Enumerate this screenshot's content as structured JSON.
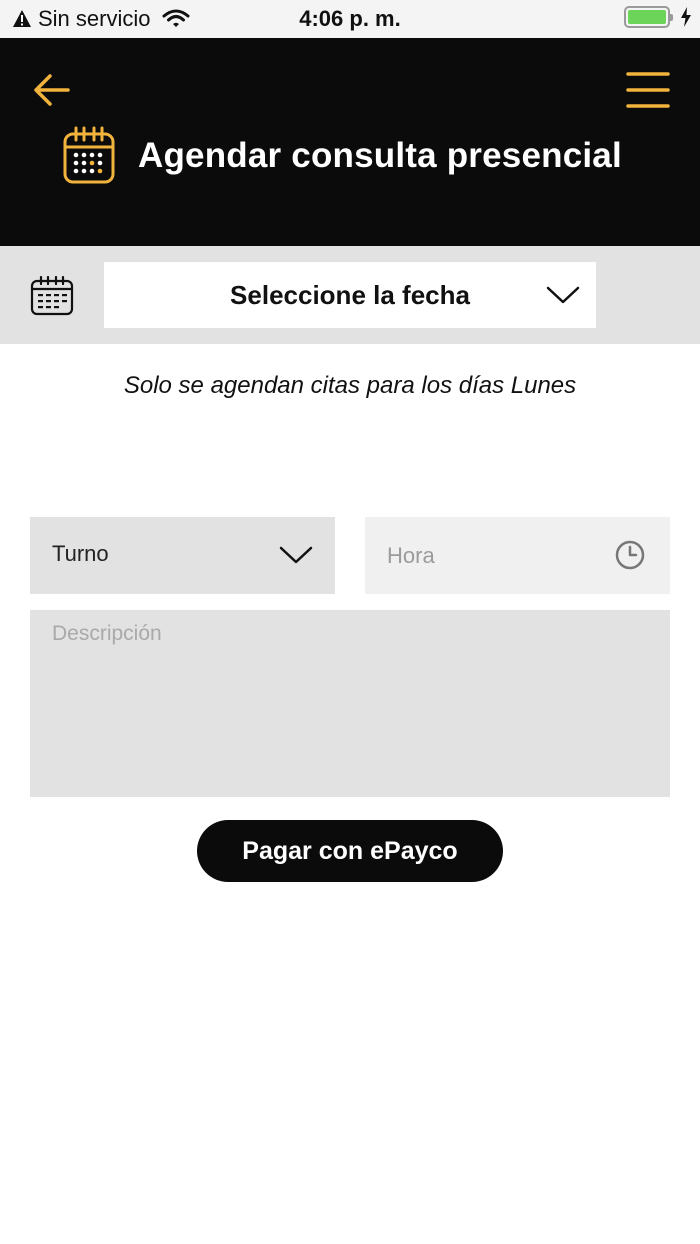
{
  "status_bar": {
    "carrier": "Sin servicio",
    "time": "4:06 p. m.",
    "battery_color": "#6dd45a"
  },
  "header": {
    "title": "Agendar consulta presencial",
    "accent_color": "#f2b33d",
    "background": "#0b0b0c",
    "icons": [
      "back-arrow-icon",
      "hamburger-menu-icon",
      "calendar-icon"
    ]
  },
  "date_bar": {
    "select_label": "Seleccione la fecha"
  },
  "info": {
    "text": "Solo se agendan citas para los días Lunes"
  },
  "form": {
    "turno_label": "Turno",
    "hora_placeholder": "Hora",
    "descripcion_placeholder": "Descripción"
  },
  "actions": {
    "pay_label": "Pagar con ePayco"
  }
}
